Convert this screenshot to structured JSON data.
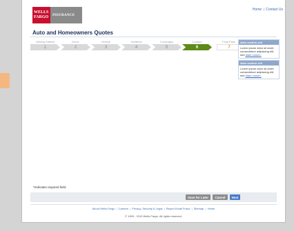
{
  "logo": {
    "brand_line1": "WELLS",
    "brand_line2": "FARGO",
    "product": "INSURANCE"
  },
  "toplinks": {
    "home": "Home",
    "separator": "|",
    "contact": "Contact Us"
  },
  "page_title": "Auto and Homeowners Quotes",
  "steps": [
    {
      "label": "Getting Started",
      "number": "1",
      "state": "done"
    },
    {
      "label": "Driver",
      "number": "2",
      "state": "done"
    },
    {
      "label": "Vehicle",
      "number": "3",
      "state": "done"
    },
    {
      "label": "Incidents",
      "number": "4",
      "state": "done"
    },
    {
      "label": "Coverages",
      "number": "5",
      "state": "done"
    },
    {
      "label": "Contact",
      "number": "6",
      "state": "active"
    },
    {
      "label": "Final Pass",
      "number": "7",
      "state": "next"
    }
  ],
  "sideboxes": [
    {
      "title": "Auto section cell",
      "body": "Lorem ipsum dolor sit amet, consectetuer adipiscing elit, sed",
      "link": "diam nonum."
    },
    {
      "title": "Auto section cell",
      "body": "Lorem ipsum dolor sit amet, consectetuer adipiscing elit, sed",
      "link": "diam nonum."
    }
  ],
  "required_note": "*Indicates required field.",
  "buttons": {
    "save_later": "Save for Later",
    "cancel": "Cancel",
    "next": "Next"
  },
  "footer": {
    "links": [
      "About Wells Fargo",
      "Careers",
      "Privacy, Security & Legal",
      "Report Email Fraud",
      "Sitemap",
      "Home"
    ],
    "separator": "|",
    "copyright": "© 1999 - 2010 Wells Fargo. All rights reserved."
  },
  "colors": {
    "active_step": "#5e8a1a",
    "next_button": "#4a7cc7",
    "brand_red": "#c8102e"
  }
}
